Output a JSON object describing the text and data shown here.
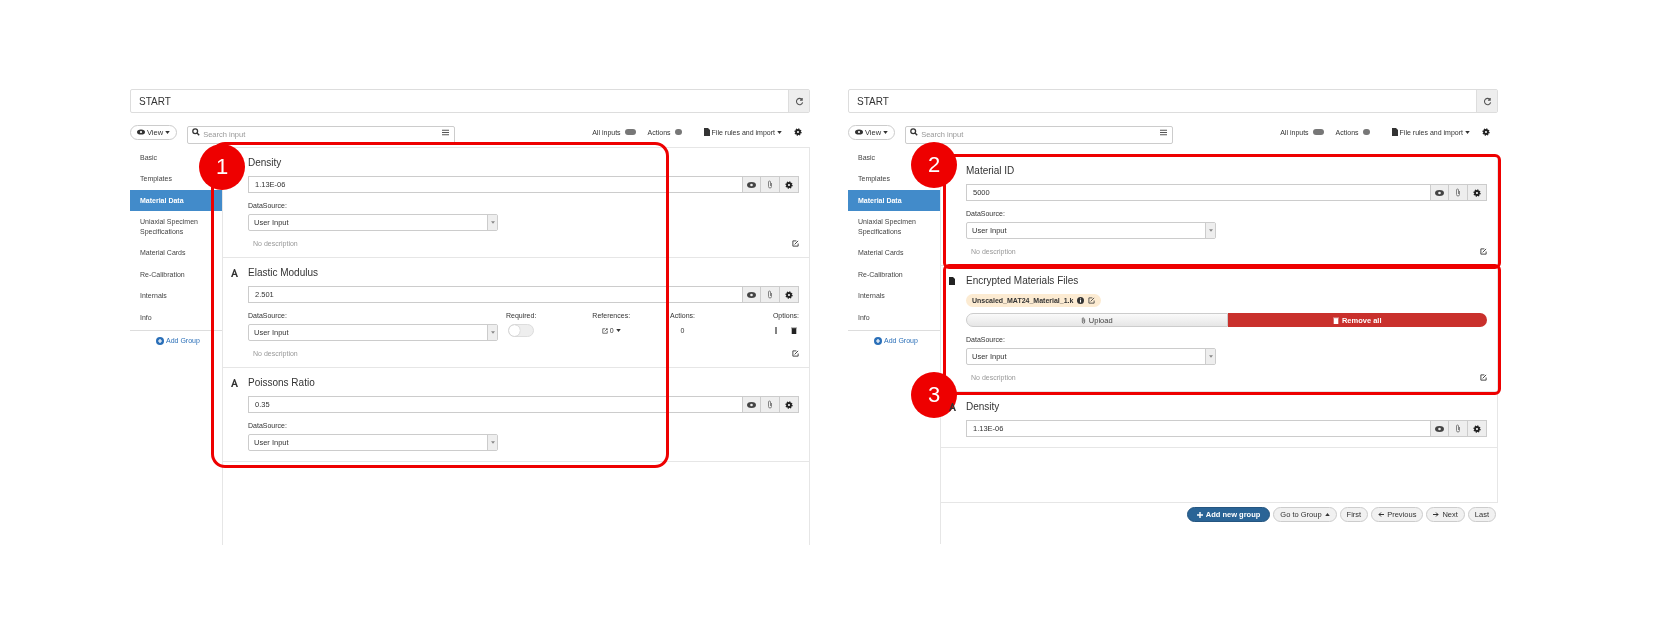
{
  "screens": [
    {
      "start": "START",
      "view_button": "View",
      "search_placeholder": "Search input",
      "all_inputs": "All inputs",
      "actions": "Actions",
      "file_rules": "File rules and import",
      "sidebar": [
        {
          "label": "Basic",
          "selected": false
        },
        {
          "label": "Templates",
          "selected": false
        },
        {
          "label": "Material Data",
          "selected": true
        },
        {
          "label": "Uniaxial Specimen Specifications",
          "selected": false
        },
        {
          "label": "Material Cards",
          "selected": false
        },
        {
          "label": "Re-Calibration",
          "selected": false
        },
        {
          "label": "Internals",
          "selected": false
        },
        {
          "label": "Info",
          "selected": false
        }
      ],
      "add_group": "Add Group",
      "groups": [
        {
          "annotation": {
            "label": "1",
            "covers_buttons": false,
            "marker_at_bottom": false
          },
          "cards": [
            {
              "title": "Density",
              "value": "1.13E-06",
              "datasource_label": "DataSource:",
              "datasource": "User Input",
              "description": "No description"
            },
            {
              "kind": "value",
              "title": "Elastic Modulus",
              "value": "2.501",
              "datasource_label": "DataSource:",
              "datasource": "User Input",
              "required_label": "Required:",
              "required": false,
              "references_label": "References:",
              "references": "0",
              "actions_label": "Actions:",
              "actions": "0",
              "options_label": "Options:",
              "description": "No description"
            },
            {
              "kind": "value",
              "title": "Poissons Ratio",
              "value": "0.35",
              "datasource_label": "DataSource:",
              "datasource": "User Input"
            }
          ]
        }
      ]
    },
    {
      "start": "START",
      "view_button": "View",
      "search_placeholder": "Search input",
      "all_inputs": "All inputs",
      "actions": "Actions",
      "file_rules": "File rules and import",
      "sidebar": [
        {
          "label": "Basic",
          "selected": false
        },
        {
          "label": "Templates",
          "selected": false
        },
        {
          "label": "Material Data",
          "selected": true
        },
        {
          "label": "Uniaxial Specimen Specifications",
          "selected": false
        },
        {
          "label": "Material Cards",
          "selected": false
        },
        {
          "label": "Re-Calibration",
          "selected": false
        },
        {
          "label": "Internals",
          "selected": false
        },
        {
          "label": "Info",
          "selected": false
        }
      ],
      "add_group": "Add Group",
      "groups": [
        {
          "annotation": {
            "label": "2",
            "covers_buttons": true,
            "marker_at_bottom": false
          },
          "cards": [
            {
              "title": "Material ID",
              "value": "5000",
              "datasource_label": "DataSource:",
              "datasource": "User Input",
              "description": "No description"
            }
          ]
        },
        {
          "annotation": {
            "label": "3",
            "covers_buttons": true,
            "marker_at_bottom": true
          },
          "cards": [
            {
              "kind": "file",
              "title": "Encrypted Materials Files",
              "file": "Unscaled_MAT24_Material_1.k",
              "upload": "Upload",
              "remove_all": "Remove all",
              "datasource_label": "DataSource:",
              "datasource": "User Input",
              "description": "No description"
            }
          ]
        },
        {
          "cards": [
            {
              "kind": "value",
              "title": "Density",
              "value": "1.13E-06"
            }
          ]
        }
      ],
      "footer": {
        "add": "Add new group",
        "goto": "Go to Group",
        "first": "First",
        "previous": "Previous",
        "next": "Next",
        "last": "Last"
      }
    }
  ]
}
